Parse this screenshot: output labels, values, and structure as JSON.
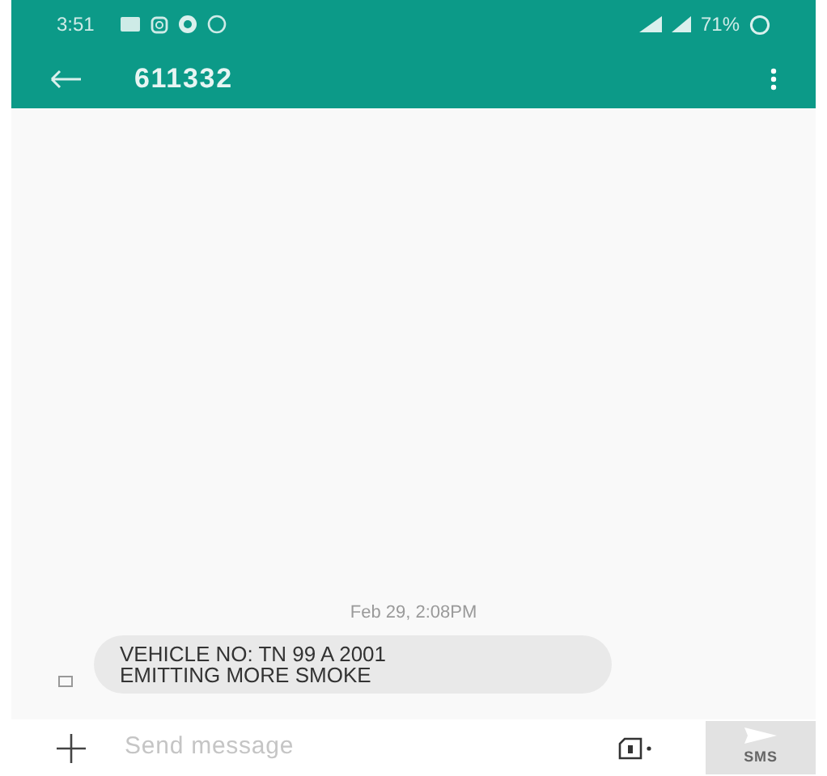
{
  "status_bar": {
    "time": "3:51",
    "battery": "71%"
  },
  "toolbar": {
    "title": "611332"
  },
  "messages": [
    {
      "timestamp": "Feb 29, 2:08PM",
      "lines": [
        "VEHICLE NO: TN 99 A 2001",
        "EMITTING MORE SMOKE"
      ]
    }
  ],
  "composer": {
    "placeholder": "Send message",
    "send_label": "SMS",
    "send_disabled": true
  }
}
